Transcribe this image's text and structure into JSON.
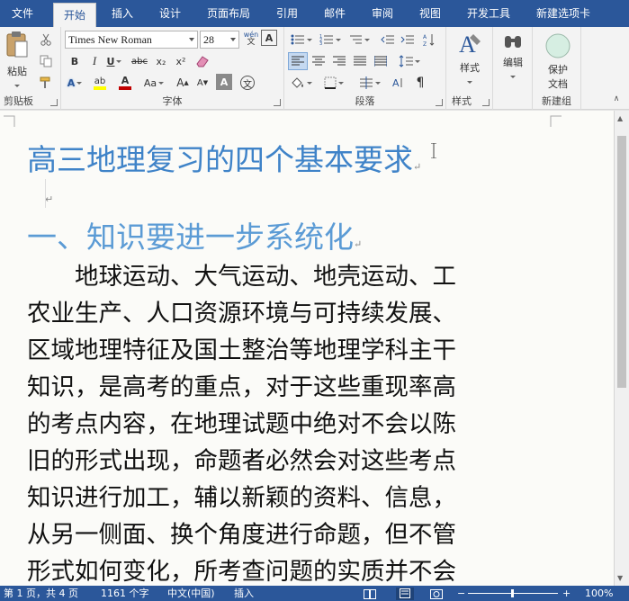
{
  "tabs": {
    "file": "文件",
    "home": "开始",
    "insert": "插入",
    "design": "设计",
    "layout": "页面布局",
    "references": "引用",
    "mailings": "邮件",
    "review": "审阅",
    "view": "视图",
    "developer": "开发工具",
    "newtab": "新建选项卡"
  },
  "ribbon": {
    "clipboard": {
      "label": "剪贴板",
      "paste": "粘贴"
    },
    "font": {
      "label": "字体",
      "name": "Times New Roman",
      "size": "28",
      "bold": "B",
      "italic": "I",
      "underline": "U",
      "strike": "abc",
      "sub": "x₂",
      "sup": "x²",
      "aa": "Aa",
      "grow": "A",
      "shrink": "A",
      "border_a": "A",
      "char_border": "A",
      "phonetic": "文",
      "wen": "wén",
      "wen2": "文",
      "font_color": "A",
      "char_shading": "A",
      "highlight": "ab"
    },
    "paragraph": {
      "label": "段落"
    },
    "styles": {
      "label": "样式",
      "button": "样式"
    },
    "editing": {
      "button": "编辑"
    },
    "newgroup": {
      "label": "新建组",
      "protect_line1": "保护",
      "protect_line2": "文档"
    }
  },
  "document": {
    "title": "高三地理复习的四个基本要求",
    "heading1": "一、知识要进一步系统化",
    "para_mark": "↵",
    "body_lines": [
      "　　地球运动、大气运动、地壳运动、工",
      "农业生产、人口资源环境与可持续发展、",
      "区域地理特征及国土整治等地理学科主干",
      "知识，是高考的重点，对于这些重现率高",
      "的考点内容，在地理试题中绝对不会以陈",
      "旧的形式出现，命题者必然会对这些考点",
      "知识进行加工，辅以新颖的资料、信息，",
      "从另一侧面、换个角度进行命题，但不管",
      "形式如何变化，所考查问题的实质并不会"
    ]
  },
  "status": {
    "page": "第 1 页，共 4 页",
    "words": "1161 个字",
    "lang": "中文(中国)",
    "mode": "插入",
    "zoom": "100%"
  },
  "colors": {
    "accent": "#2b579a",
    "title": "#3f83c8",
    "heading": "#5b9bd5"
  }
}
